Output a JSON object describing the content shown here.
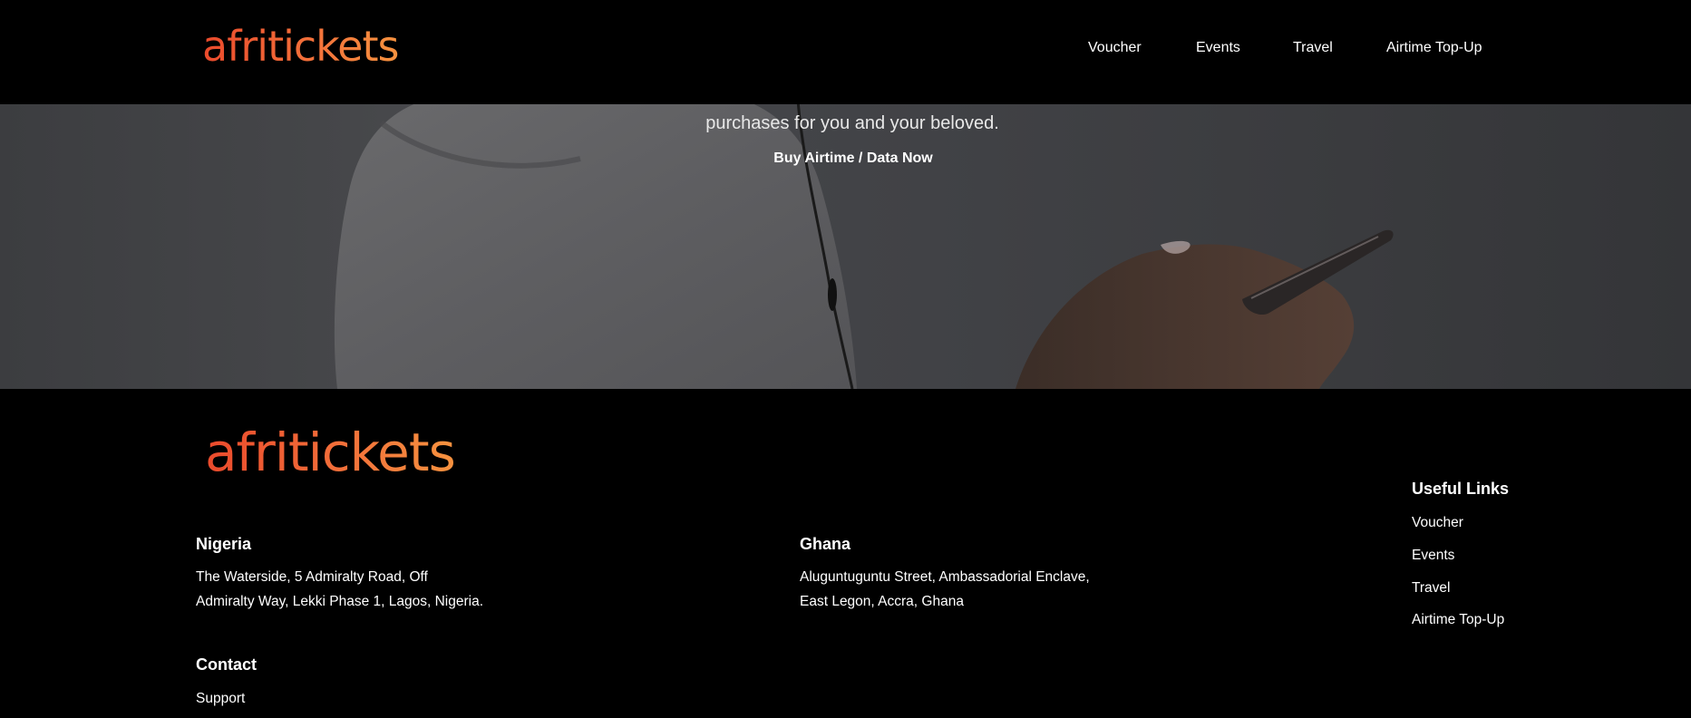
{
  "brand": {
    "logo_text": "afritickets",
    "gradient": [
      "#ea4a2c",
      "#f6923f"
    ]
  },
  "nav": {
    "items": [
      {
        "label": "Voucher"
      },
      {
        "label": "Events"
      },
      {
        "label": "Travel"
      },
      {
        "label": "Airtime Top-Up"
      }
    ]
  },
  "hero": {
    "subtitle_visible": "purchases for you and your beloved.",
    "cta_label": "Buy Airtime / Data Now"
  },
  "footer": {
    "nigeria": {
      "title": "Nigeria",
      "address": [
        "The Waterside, 5 Admiralty Road, Off",
        "Admiralty Way, Lekki Phase 1, Lagos, Nigeria."
      ]
    },
    "ghana": {
      "title": "Ghana",
      "address": [
        "Aluguntuguntu Street, Ambassadorial Enclave,",
        "East Legon, Accra, Ghana"
      ]
    },
    "contact": {
      "title": "Contact",
      "support": "Support"
    },
    "useful_links": {
      "title": "Useful Links",
      "items": [
        {
          "label": "Voucher"
        },
        {
          "label": "Events"
        },
        {
          "label": "Travel"
        },
        {
          "label": "Airtime Top-Up"
        }
      ]
    }
  }
}
